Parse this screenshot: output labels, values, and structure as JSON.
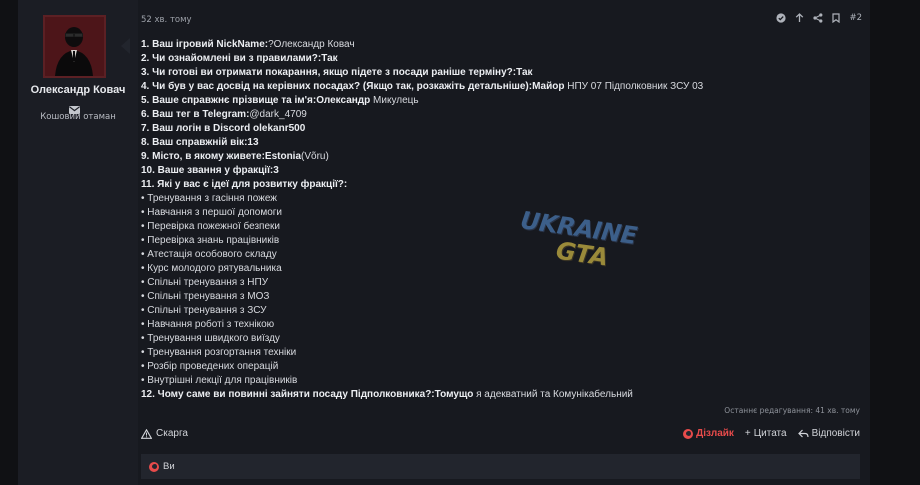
{
  "user": {
    "name": "Олександр Ковач",
    "title": "Кошовий отаман"
  },
  "post": {
    "time": "52 хв. тому",
    "number": "#2",
    "lines": [
      {
        "q": "1. Ваш ігровий NickName:",
        "a": "?Олександр Ковач"
      },
      {
        "q": "2. Чи ознайомлені ви з правилами?:Так",
        "a": ""
      },
      {
        "q": "3. Чи готові ви отримати покарання, якщо підете з посади раніше терміну?:Так",
        "a": ""
      },
      {
        "q": "4. Чи був у вас досвід на керівних посадах? (Якщо так, розкажіть детальніше):Майор",
        "a": " НПУ 07 Підполковник ЗСУ 03"
      },
      {
        "q": "5. Ваше справжнє прізвище та ім'я:Олександр",
        "a": " Микулець"
      },
      {
        "q": "6. Ваш тег в Telegram:",
        "a": "@dark_4709"
      },
      {
        "q": "7. Ваш логін в Discord olekanr500",
        "a": ""
      },
      {
        "q": "8. Ваш справжній вік:13",
        "a": ""
      },
      {
        "q": "9. Місто, в якому живете:Estonia",
        "a": "(Võru)"
      },
      {
        "q": "10. Ваше звання у фракції:3",
        "a": ""
      },
      {
        "q": "11. Які у вас є ідеї для розвитку фракції?:",
        "a": ""
      },
      {
        "q": "",
        "a": "• Тренування з гасіння пожеж"
      },
      {
        "q": "",
        "a": "• Навчання з першої допомоги"
      },
      {
        "q": "",
        "a": "• Перевірка пожежної безпеки"
      },
      {
        "q": "",
        "a": "• Перевірка знань працівників"
      },
      {
        "q": "",
        "a": "• Атестація особового складу"
      },
      {
        "q": "",
        "a": "• Курс молодого рятувальника"
      },
      {
        "q": "",
        "a": "• Спільні тренування з НПУ"
      },
      {
        "q": "",
        "a": "• Спільні тренування з МОЗ"
      },
      {
        "q": "",
        "a": "• Спільні тренування з ЗСУ"
      },
      {
        "q": "",
        "a": "• Навчання роботі з технікою"
      },
      {
        "q": "",
        "a": "• Тренування швидкого виїзду"
      },
      {
        "q": "",
        "a": "• Тренування розгортання техніки"
      },
      {
        "q": "",
        "a": "• Розбір проведених операцій"
      },
      {
        "q": "",
        "a": "• Внутрішні лекції для працівників"
      },
      {
        "q": "12. Чому саме ви повинні зайняти посаду Підполковника?:Томущо",
        "a": " я адекватний та Комунікабельний"
      }
    ],
    "edited": "Останнє редагування: 41 хв. тому"
  },
  "watermark": {
    "line1": "UKRAINE",
    "line2": "GTA"
  },
  "actions": {
    "report": "Скарга",
    "like": "Дізлайк",
    "quote": "Цитата",
    "reply": "Відповісти"
  },
  "likes": {
    "text": "Ви"
  },
  "colors": {
    "accent": "#e84b4b",
    "background": "#17191f",
    "sidebar": "#1b1d24"
  }
}
